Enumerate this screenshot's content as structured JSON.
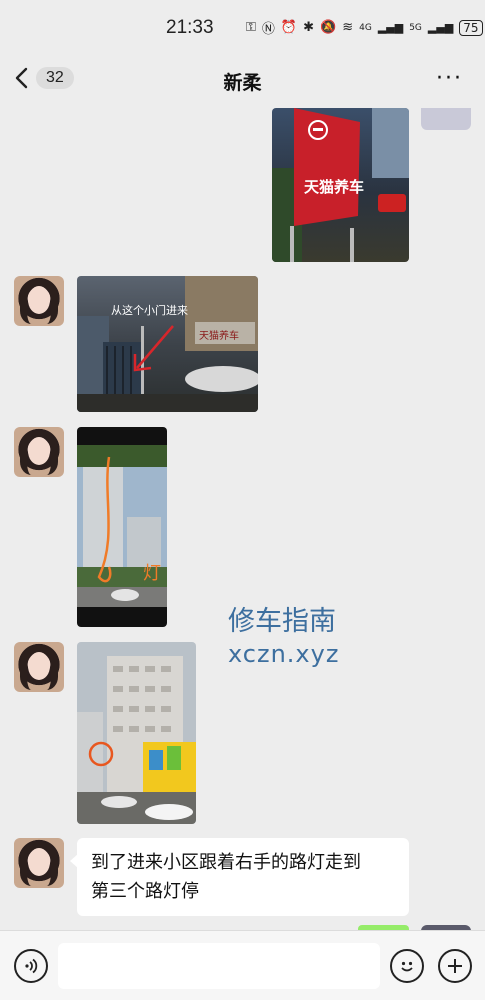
{
  "status": {
    "time": "21:33",
    "battery": "75",
    "net1": "4G",
    "net2": "5G"
  },
  "header": {
    "back_count": "32",
    "title": "新柔",
    "more_label": "···"
  },
  "messages": [
    {
      "type": "image",
      "from": "self",
      "image_text": "天猫养车"
    },
    {
      "type": "image",
      "from": "contact",
      "caption_text": "从这个小门进来",
      "sign_text": "天猫养车"
    },
    {
      "type": "image",
      "from": "contact",
      "annotation_text": "灯"
    },
    {
      "type": "image",
      "from": "contact"
    },
    {
      "type": "text",
      "from": "contact",
      "lines": [
        "到了进来小区跟着右手的路灯走到",
        "第三个路灯停"
      ]
    }
  ],
  "watermark": {
    "line1": "修车指南",
    "line2": "xczn.xyz"
  },
  "input_bar": {
    "voice_icon": "voice-icon",
    "emoji_icon": "emoji-icon",
    "plus_icon": "plus-icon"
  },
  "colors": {
    "background": "#ededed",
    "bubble": "#ffffff",
    "watermark": "#3d6f9f",
    "self_bubble": "#95ec69"
  }
}
